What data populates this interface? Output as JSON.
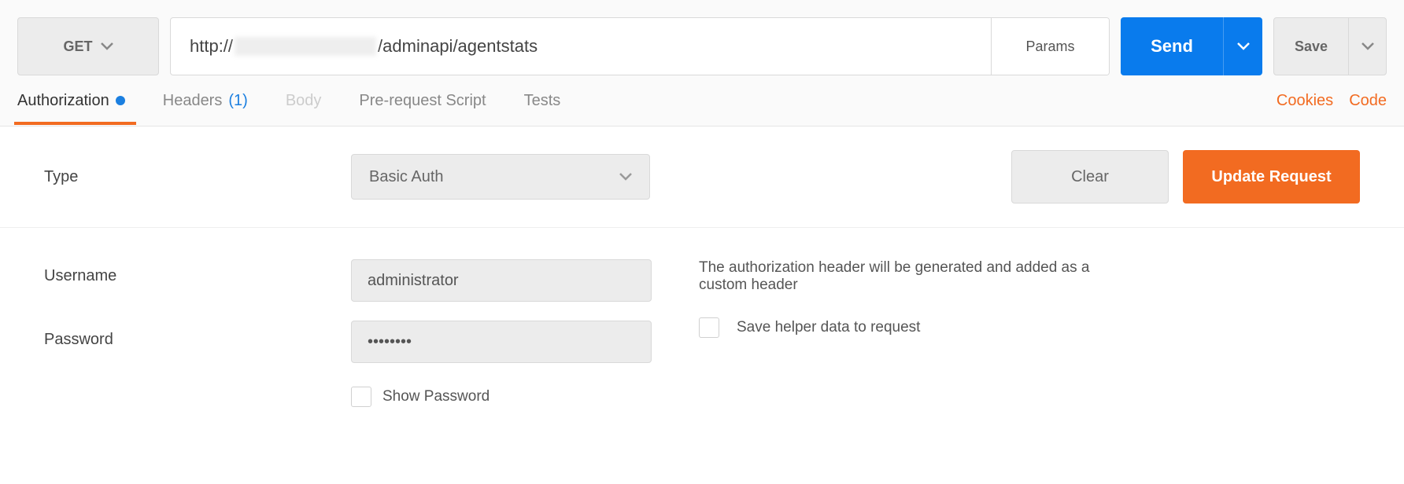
{
  "topbar": {
    "method": "GET",
    "url_prefix": "http://",
    "url_suffix": "/adminapi/agentstats",
    "params_label": "Params",
    "send_label": "Send",
    "save_label": "Save"
  },
  "tabs": {
    "authorization": "Authorization",
    "headers": "Headers",
    "headers_count": "(1)",
    "body": "Body",
    "prerequest": "Pre-request Script",
    "tests": "Tests",
    "cookies": "Cookies",
    "code": "Code"
  },
  "auth": {
    "type_label": "Type",
    "type_value": "Basic Auth",
    "clear_label": "Clear",
    "update_label": "Update Request"
  },
  "creds": {
    "username_label": "Username",
    "username_value": "administrator",
    "password_label": "Password",
    "password_value": "••••••••",
    "show_password_label": "Show Password",
    "info_text": "The authorization header will be generated and added as a custom header",
    "save_helper_label": "Save helper data to request"
  }
}
